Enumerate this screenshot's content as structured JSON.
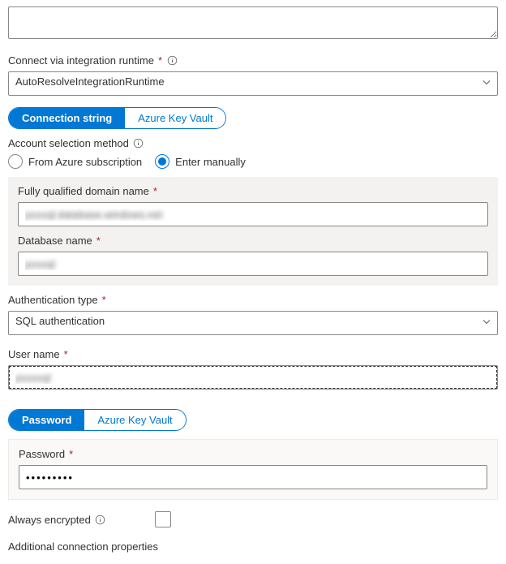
{
  "top_textarea": {
    "value": ""
  },
  "ir_section": {
    "label": "Connect via integration runtime",
    "required": "*",
    "value": "AutoResolveIntegrationRuntime"
  },
  "conn_tabs": {
    "active": "Connection string",
    "inactive": "Azure Key Vault"
  },
  "account_method": {
    "label": "Account selection method",
    "options": {
      "subscription": "From Azure subscription",
      "manual": "Enter manually"
    },
    "selected": "manual"
  },
  "fqdn": {
    "label": "Fully qualified domain name",
    "required": "*",
    "value": "pxxxql.database.windows.net"
  },
  "dbname": {
    "label": "Database name",
    "required": "*",
    "value": "pxxxql"
  },
  "authtype": {
    "label": "Authentication type",
    "required": "*",
    "value": "SQL authentication"
  },
  "username": {
    "label": "User name",
    "required": "*",
    "value": "pxxxxql"
  },
  "pwd_tabs": {
    "active": "Password",
    "inactive": "Azure Key Vault"
  },
  "password": {
    "label": "Password",
    "required": "*",
    "value": "•••••••••"
  },
  "always_encrypted": {
    "label": "Always encrypted"
  },
  "additional_props": {
    "label": "Additional connection properties"
  }
}
